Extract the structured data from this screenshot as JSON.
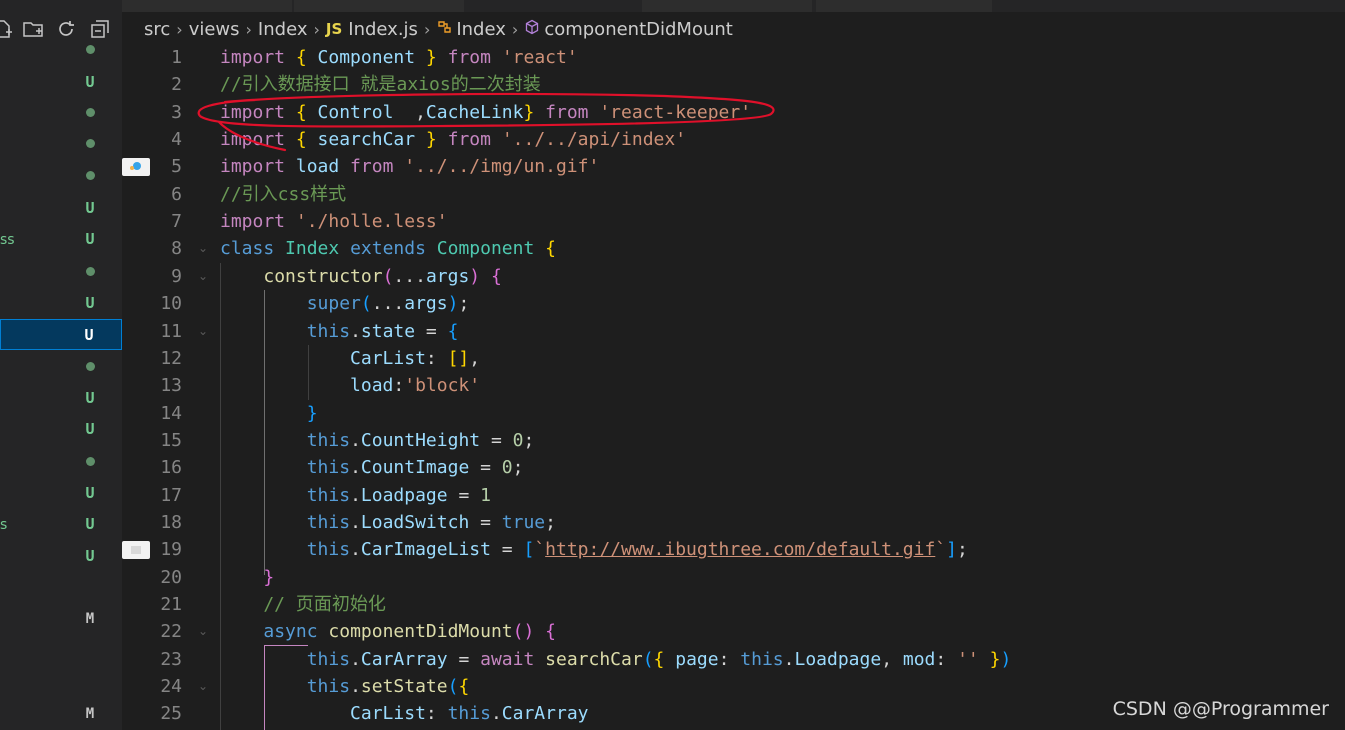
{
  "breadcrumbs": {
    "items": [
      "src",
      "views",
      "Index",
      "Index.js",
      "Index",
      "componentDidMount"
    ],
    "js_badge": "JS",
    "separator": "›"
  },
  "sidebar": {
    "toolbar_icons": [
      "new-file-icon",
      "new-folder-icon",
      "refresh-icon",
      "collapse-all-icon"
    ],
    "fragments": [
      "ss",
      "s"
    ],
    "status_items": [
      {
        "status": "dot"
      },
      {
        "status": "U"
      },
      {
        "status": "dot"
      },
      {
        "status": "dot"
      },
      {
        "status": "dot"
      },
      {
        "status": "U"
      },
      {
        "status": "U"
      },
      {
        "status": "dot"
      },
      {
        "status": "U"
      },
      {
        "status": "U",
        "selected": true
      },
      {
        "status": "dot"
      },
      {
        "status": "U"
      },
      {
        "status": "U"
      },
      {
        "status": "dot"
      },
      {
        "status": "U"
      },
      {
        "status": "U"
      },
      {
        "status": "U"
      },
      {
        "status": "M"
      },
      {
        "status": "M"
      }
    ]
  },
  "editor": {
    "line_numbers": [
      "1",
      "2",
      "3",
      "4",
      "5",
      "6",
      "7",
      "8",
      "9",
      "10",
      "11",
      "12",
      "13",
      "14",
      "15",
      "16",
      "17",
      "18",
      "19",
      "20",
      "21",
      "22",
      "23",
      "24",
      "25"
    ],
    "lines": [
      "import { Component } from 'react'",
      "//引入数据接口 就是axios的二次封装",
      "import { Control ,CacheLink} from 'react-keeper'",
      "import { searchCar } from '../../api/index'",
      "import load from '../../img/un.gif'",
      "//引入css样式",
      "import './holle.less'",
      "class Index extends Component {",
      "    constructor(...args) {",
      "        super(...args);",
      "        this.state = {",
      "            CarList: [],",
      "            load:'block'",
      "        }",
      "        this.CountHeight = 0;",
      "        this.CountImage = 0;",
      "        this.Loadpage = 1",
      "        this.LoadSwitch = true;",
      "        this.CarImageList = [`http://www.ibugthree.com/default.gif`];",
      "    }",
      "    // 页面初始化",
      "    async componentDidMount() {",
      "        this.CarArray = await searchCar({ page: this.Loadpage, mod: '' })",
      "        this.setState({",
      "            CarList: this.CarArray"
    ]
  },
  "watermark": "CSDN @@Programmer",
  "colors": {
    "keyword": "#c586c0",
    "storage": "#569cd6",
    "comment": "#6a9955",
    "string": "#ce9178",
    "variable": "#9cdcfe",
    "type": "#4ec9b0",
    "function": "#dcdcaa",
    "number": "#b5cea8",
    "annotation": "#e0102a"
  }
}
